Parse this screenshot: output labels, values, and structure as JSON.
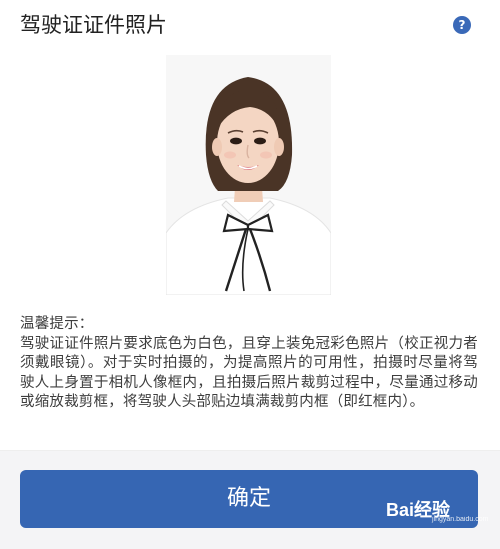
{
  "header": {
    "title": "驾驶证证件照片",
    "help_icon_glyph": "?"
  },
  "tips": {
    "heading": "温馨提示：",
    "body": "驾驶证证件照片要求底色为白色，且穿上装免冠彩色照片（校正视力者须戴眼镜）。对于实时拍摄的，为提高照片的可用性，拍摄时尽量将驾驶人上身置于相机人像框内，且拍摄后照片裁剪过程中，尽量通过移动或缩放裁剪框，将驾驶人头部贴边填满裁剪内框（即红框内）。"
  },
  "actions": {
    "confirm_label": "确定"
  },
  "watermark": {
    "brand": "Bai经验",
    "url": "jingyan.baidu.com"
  },
  "colors": {
    "accent": "#3666b3",
    "help_icon": "#3a69b8",
    "bottom_bar": "#f4f4f6"
  }
}
